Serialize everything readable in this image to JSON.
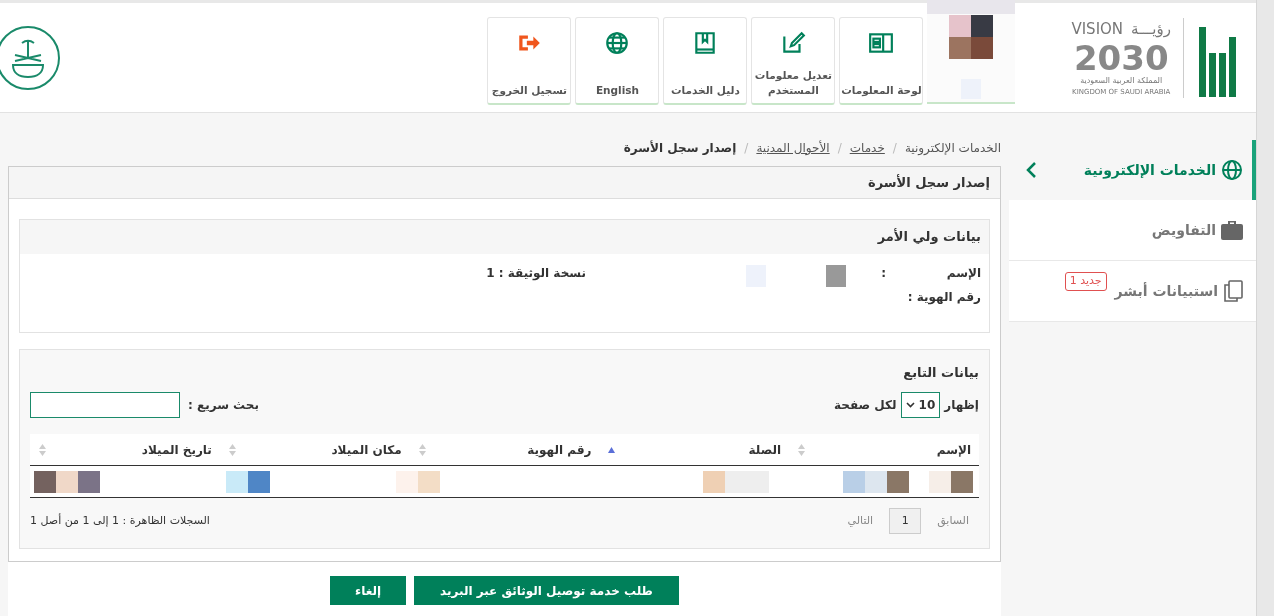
{
  "header": {
    "brand": {
      "vision_latin": "VISION",
      "vision_arabic": "رؤيـــة",
      "year": "2030",
      "country_arabic": "المملكة العربية السعودية",
      "country_latin": "KINGDOM OF SAUDI ARABIA"
    },
    "nav": [
      {
        "label": "لوحة المعلومات"
      },
      {
        "label": "تعديل معلومات المستخدم"
      },
      {
        "label": "دليل الخدمات"
      },
      {
        "label": "English"
      },
      {
        "label": "تسجيل الخروج"
      }
    ]
  },
  "sidebar": {
    "items": [
      {
        "label": "الخدمات الإلكترونية",
        "selected": true
      },
      {
        "label": "التفاويض",
        "selected": false
      },
      {
        "label": "استبيانات أبشر",
        "selected": false,
        "badge": "جديد 1"
      }
    ]
  },
  "breadcrumb": [
    {
      "label": "الخدمات الإلكترونية",
      "kind": "text"
    },
    {
      "label": "/",
      "kind": "separator"
    },
    {
      "label": "خدمات",
      "kind": "link"
    },
    {
      "label": "/",
      "kind": "separator"
    },
    {
      "label": "الأحوال المدنية",
      "kind": "link"
    },
    {
      "label": "/",
      "kind": "separator"
    },
    {
      "label": "إصدار سجل الأسرة",
      "kind": "current"
    }
  ],
  "panel": {
    "title": "إصدار سجل الأسرة",
    "guardian": {
      "title": "بيانات ولي الأمر",
      "name_label": "الإسم",
      "colon": ":",
      "id_label": "رقم الهوية :",
      "copy_label": "نسخة الوثيقة : 1"
    },
    "dependents": {
      "title": "بيانات التابع",
      "show_label": "إظهار",
      "page_size": "10",
      "per_page_label": "لكل صفحة",
      "search_label": "بحث سريع :",
      "table": {
        "columns": [
          {
            "label": "الإسم",
            "sorted": false
          },
          {
            "label": "الصلة",
            "sorted": true
          },
          {
            "label": "رقم الهوية",
            "sorted": false
          },
          {
            "label": "مكان الميلاد",
            "sorted": false
          },
          {
            "label": "تاريخ الميلاد",
            "sorted": false
          }
        ]
      },
      "pager": [
        {
          "label": "السابق",
          "selected": false
        },
        {
          "label": "1",
          "selected": true
        },
        {
          "label": "التالي",
          "selected": false
        }
      ],
      "info": "السجلات الظاهرة : 1 إلى 1 من أصل 1"
    }
  },
  "buttons": [
    {
      "label": "طلب خدمة توصيل الوثائق عبر البريد"
    },
    {
      "label": "إلغاء"
    }
  ]
}
